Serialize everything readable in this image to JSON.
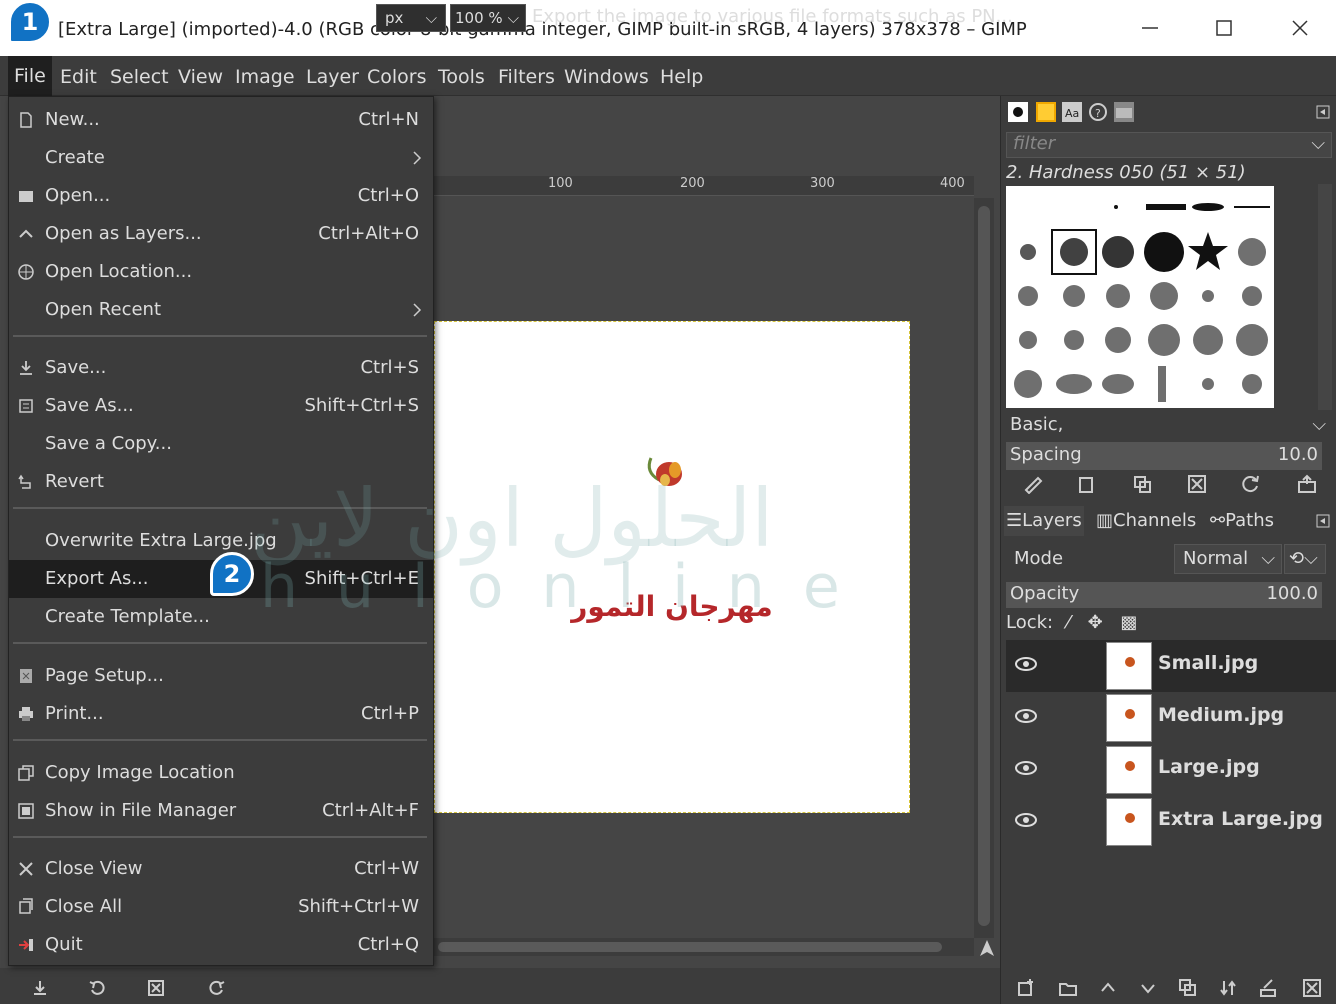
{
  "window": {
    "title": "[Extra Large] (imported)-4.0 (RGB color 8-bit gamma integer, GIMP built-in sRGB, 4 layers) 378x378 – GIMP"
  },
  "menubar": [
    "File",
    "Edit",
    "Select",
    "View",
    "Image",
    "Layer",
    "Colors",
    "Tools",
    "Filters",
    "Windows",
    "Help"
  ],
  "file_menu": {
    "items": [
      {
        "label": "New...",
        "accel": "Ctrl+N",
        "icon": "new-file-icon"
      },
      {
        "label": "Create",
        "accel": "",
        "icon": "",
        "submenu": true
      },
      {
        "label": "Open...",
        "accel": "Ctrl+O",
        "icon": "open-icon"
      },
      {
        "label": "Open as Layers...",
        "accel": "Ctrl+Alt+O",
        "icon": "open-layers-icon"
      },
      {
        "label": "Open Location...",
        "accel": "",
        "icon": "globe-icon"
      },
      {
        "label": "Open Recent",
        "accel": "",
        "icon": "",
        "submenu": true
      },
      {
        "label": "Save...",
        "accel": "Ctrl+S",
        "icon": "save-icon"
      },
      {
        "label": "Save As...",
        "accel": "Shift+Ctrl+S",
        "icon": "save-as-icon"
      },
      {
        "label": "Save a Copy...",
        "accel": "",
        "icon": ""
      },
      {
        "label": "Revert",
        "accel": "",
        "icon": "revert-icon"
      },
      {
        "label": "Overwrite Extra Large.jpg",
        "accel": "",
        "icon": ""
      },
      {
        "label": "Export As...",
        "accel": "Shift+Ctrl+E",
        "icon": ""
      },
      {
        "label": "Create Template...",
        "accel": "",
        "icon": ""
      },
      {
        "label": "Page Setup...",
        "accel": "",
        "icon": "page-setup-icon"
      },
      {
        "label": "Print...",
        "accel": "Ctrl+P",
        "icon": "print-icon"
      },
      {
        "label": "Copy Image Location",
        "accel": "",
        "icon": "copy-icon"
      },
      {
        "label": "Show in File Manager",
        "accel": "Ctrl+Alt+F",
        "icon": "file-manager-icon"
      },
      {
        "label": "Close View",
        "accel": "Ctrl+W",
        "icon": "close-icon"
      },
      {
        "label": "Close All",
        "accel": "Shift+Ctrl+W",
        "icon": "close-all-icon"
      },
      {
        "label": "Quit",
        "accel": "Ctrl+Q",
        "icon": "quit-icon"
      }
    ]
  },
  "ruler": {
    "ticks": [
      "100",
      "200",
      "300",
      "400"
    ]
  },
  "canvas": {
    "image_text": "مهرجان التمور"
  },
  "status": {
    "unit": "px",
    "zoom": "100 %",
    "message": "Export the image to various file formats such as PN..."
  },
  "brushes": {
    "filter_placeholder": "filter",
    "selected": "2. Hardness 050 (51 × 51)",
    "tag": "Basic,",
    "spacing_label": "Spacing",
    "spacing_value": "10.0"
  },
  "layers_panel": {
    "tabs": [
      "Layers",
      "Channels",
      "Paths"
    ],
    "mode_label": "Mode",
    "mode_value": "Normal",
    "opacity_label": "Opacity",
    "opacity_value": "100.0",
    "lock_label": "Lock:",
    "layers": [
      "Small.jpg",
      "Medium.jpg",
      "Large.jpg",
      "Extra Large.jpg"
    ]
  },
  "annotations": {
    "step1": "1",
    "step2": "2"
  },
  "watermark": {
    "latin": "hulonline",
    "arabic": "الحلول اون لاين"
  },
  "colors": {
    "accent": "#1172c4",
    "menu_bg": "#3c3c3c",
    "highlight": "#1e1e1e",
    "logo_text": "#b5272a"
  }
}
